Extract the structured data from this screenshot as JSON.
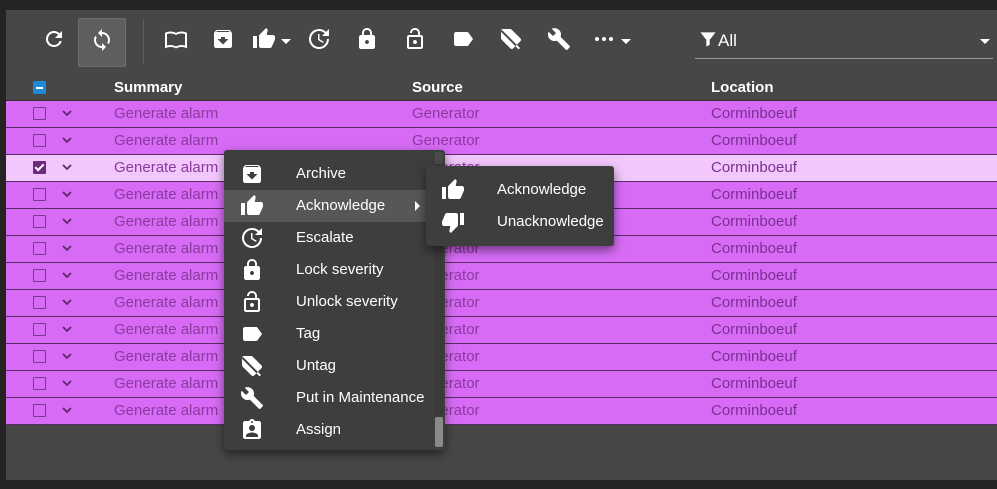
{
  "toolbar": {
    "buttons": [
      {
        "icon": "refresh-icon"
      },
      {
        "icon": "auto-refresh-icon"
      },
      {
        "icon": "open-book-icon"
      },
      {
        "icon": "archive-icon"
      },
      {
        "icon": "thumb-up-icon"
      },
      {
        "icon": "escalate-icon"
      },
      {
        "icon": "lock-icon"
      },
      {
        "icon": "unlock-icon"
      },
      {
        "icon": "tag-icon"
      },
      {
        "icon": "untag-icon"
      },
      {
        "icon": "wrench-icon"
      },
      {
        "icon": "more-icon"
      }
    ],
    "filter_value": "All"
  },
  "grid": {
    "columns": [
      "Summary",
      "Source",
      "Location"
    ],
    "rows": [
      {
        "summary": "Generate alarm",
        "source": "Generator",
        "location": "Corminboeuf",
        "checked": false
      },
      {
        "summary": "Generate alarm",
        "source": "Generator",
        "location": "Corminboeuf",
        "checked": false
      },
      {
        "summary": "Generate alarm",
        "source": "Generator",
        "location": "Corminboeuf",
        "checked": true
      },
      {
        "summary": "Generate alarm",
        "source": "Generator",
        "location": "Corminboeuf",
        "checked": false
      },
      {
        "summary": "Generate alarm",
        "source": "Generator",
        "location": "Corminboeuf",
        "checked": false
      },
      {
        "summary": "Generate alarm",
        "source": "Generator",
        "location": "Corminboeuf",
        "checked": false
      },
      {
        "summary": "Generate alarm",
        "source": "Generator",
        "location": "Corminboeuf",
        "checked": false
      },
      {
        "summary": "Generate alarm",
        "source": "Generator",
        "location": "Corminboeuf",
        "checked": false
      },
      {
        "summary": "Generate alarm",
        "source": "Generator",
        "location": "Corminboeuf",
        "checked": false
      },
      {
        "summary": "Generate alarm",
        "source": "Generator",
        "location": "Corminboeuf",
        "checked": false
      },
      {
        "summary": "Generate alarm",
        "source": "Generator",
        "location": "Corminboeuf",
        "checked": false
      },
      {
        "summary": "Generate alarm",
        "source": "Generator",
        "location": "Corminboeuf",
        "checked": false
      }
    ]
  },
  "context_menu": {
    "items": [
      {
        "label": "Archive",
        "icon": "archive-icon"
      },
      {
        "label": "Acknowledge",
        "icon": "thumb-up-icon"
      },
      {
        "label": "Escalate",
        "icon": "escalate-icon"
      },
      {
        "label": "Lock severity",
        "icon": "lock-icon"
      },
      {
        "label": "Unlock severity",
        "icon": "unlock-icon"
      },
      {
        "label": "Tag",
        "icon": "tag-icon"
      },
      {
        "label": "Untag",
        "icon": "untag-icon"
      },
      {
        "label": "Put in Maintenance",
        "icon": "wrench-icon"
      },
      {
        "label": "Assign",
        "icon": "assign-icon"
      }
    ]
  },
  "submenu": {
    "items": [
      {
        "label": "Acknowledge",
        "icon": "thumb-up-icon"
      },
      {
        "label": "Unacknowledge",
        "icon": "thumb-down-icon"
      }
    ]
  },
  "colors": {
    "row_bg": "#d76bf6",
    "row_selected_bg": "#f2c7fc",
    "menu_bg": "#3e3e3e",
    "accent": "#1d8bd8"
  }
}
